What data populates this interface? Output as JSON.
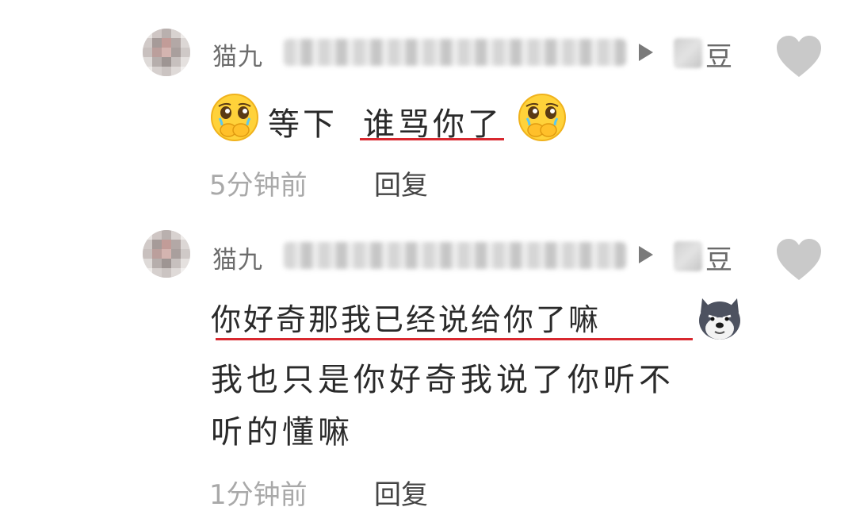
{
  "comments": [
    {
      "username": "猫九",
      "grade_char": "豆",
      "text_1_prefix": "等下",
      "text_1_highlight": "谁骂你了",
      "time": "5分钟前",
      "reply_label": "回复",
      "emoji": "pleading-face-hands-icon"
    },
    {
      "username": "猫九",
      "grade_char": "豆",
      "line_1": "你好奇那我已经说给你了嘛",
      "line_2": "我也只是你好奇我说了你听不",
      "line_3": "听的懂嘛",
      "time": "1分钟前",
      "reply_label": "回复",
      "emoji": "dog-face-sticker-icon"
    }
  ],
  "colors": {
    "underline": "#d8282f",
    "heart": "#c9c9c9",
    "meta_time": "#a9a9a9",
    "reply": "#444444"
  }
}
